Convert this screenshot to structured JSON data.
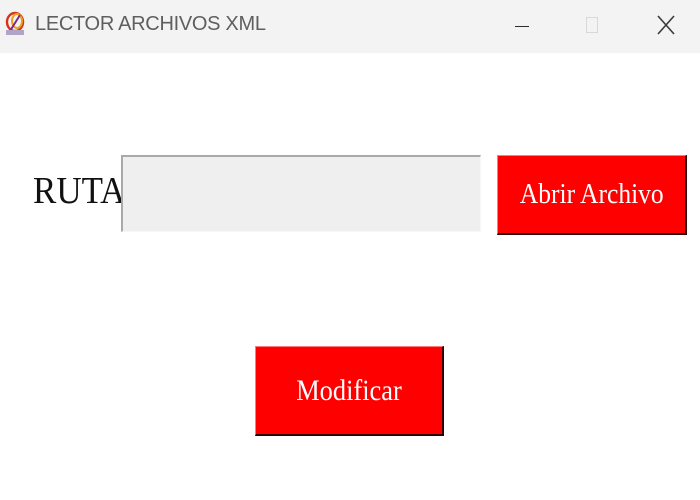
{
  "window": {
    "title": "LECTOR ARCHIVOS XML",
    "app_icon": "app-logo-icon",
    "controls": {
      "minimize_icon": "minimize-icon",
      "maximize_icon": "maximize-icon",
      "close_icon": "close-icon"
    }
  },
  "form": {
    "ruta_label": "RUTA",
    "ruta_value": "",
    "ruta_placeholder": "",
    "open_button_label": "Abrir Archivo",
    "modify_button_label": "Modificar"
  },
  "colors": {
    "accent_button": "#ff0000",
    "button_text": "#ffffff",
    "input_background": "#efefef",
    "titlebar_background": "#f3f3f3"
  }
}
